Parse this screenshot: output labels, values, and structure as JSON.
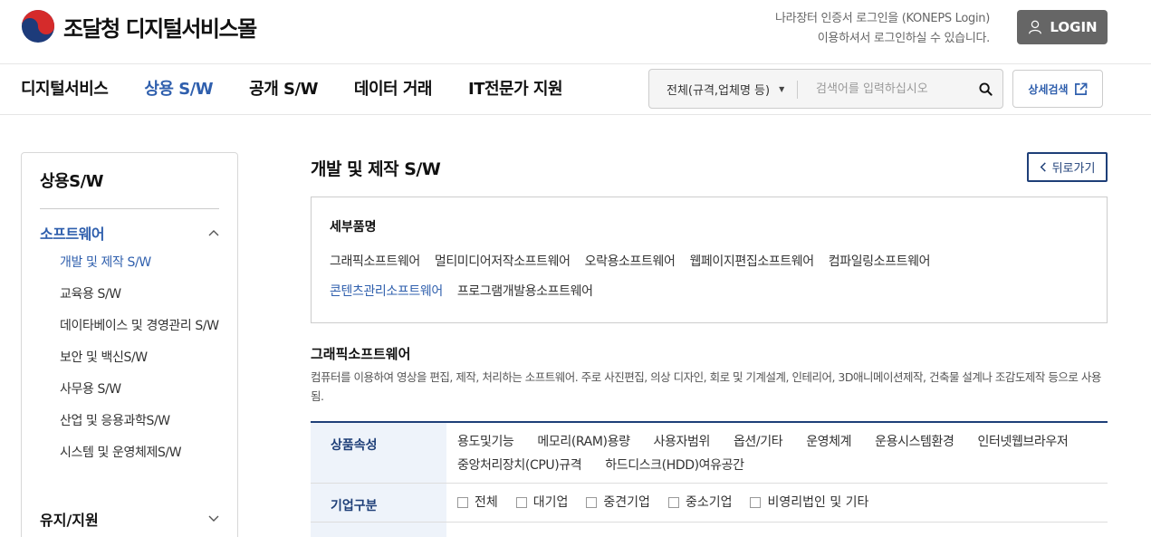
{
  "header": {
    "logo_text": "조달청 디지털서비스몰",
    "login_msg_line1": "나라장터 인증서 로그인을 (KONEPS Login)",
    "login_msg_line2": "이용하셔서 로그인하실 수 있습니다.",
    "login_label": "LOGIN"
  },
  "gnb": [
    "디지털서비스",
    "상용 S/W",
    "공개 S/W",
    "데이터 거래",
    "IT전문가 지원"
  ],
  "search": {
    "select_value": "전체(규격,업체명 등)",
    "placeholder": "검색어를 입력하십시오",
    "advanced_label": "상세검색"
  },
  "sidebar": {
    "title": "상용S/W",
    "group1": "소프트웨어",
    "items": [
      "개발 및 제작 S/W",
      "교육용 S/W",
      "데이타베이스 및 경영관리 S/W",
      "보안 및 백신S/W",
      "사무용 S/W",
      "산업 및 응용과학S/W",
      "시스템 및 운영체제S/W"
    ],
    "group2": "유지/지원"
  },
  "main": {
    "title": "개발 및 제작 S/W",
    "back_label": "뒤로가기",
    "detail_head": "세부품명",
    "detail_items": [
      "그래픽소프트웨어",
      "멀티미디어저작소프트웨어",
      "오락용소프트웨어",
      "웹페이지편집소프트웨어",
      "컴파일링소프트웨어",
      "콘텐츠관리소프트웨어",
      "프로그램개발용소프트웨어"
    ],
    "category_title": "그래픽소프트웨어",
    "category_desc": "컴퓨터를 이용하여 영상을 편집, 제작, 처리하는 소프트웨어. 주로 사진편집, 의상 디자인, 회로 및 기계설계, 인테리어, 3D애니메이션제작, 건축물 설계나 조감도제작 등으로 사용됨."
  },
  "filter": {
    "attr_head": "상품속성",
    "attrs": [
      "용도및기능",
      "메모리(RAM)용량",
      "사용자범위",
      "옵션/기타",
      "운영체계",
      "운용시스템환경",
      "인터넷웹브라우저",
      "중앙처리장치(CPU)규격",
      "하드디스크(HDD)여유공간"
    ],
    "company_head": "기업구분",
    "companies": [
      "전체",
      "대기업",
      "중견기업",
      "중소기업",
      "비영리법인 및 기타"
    ]
  },
  "colors": {
    "accent": "#2f5fad",
    "navy": "#1e3f78"
  }
}
